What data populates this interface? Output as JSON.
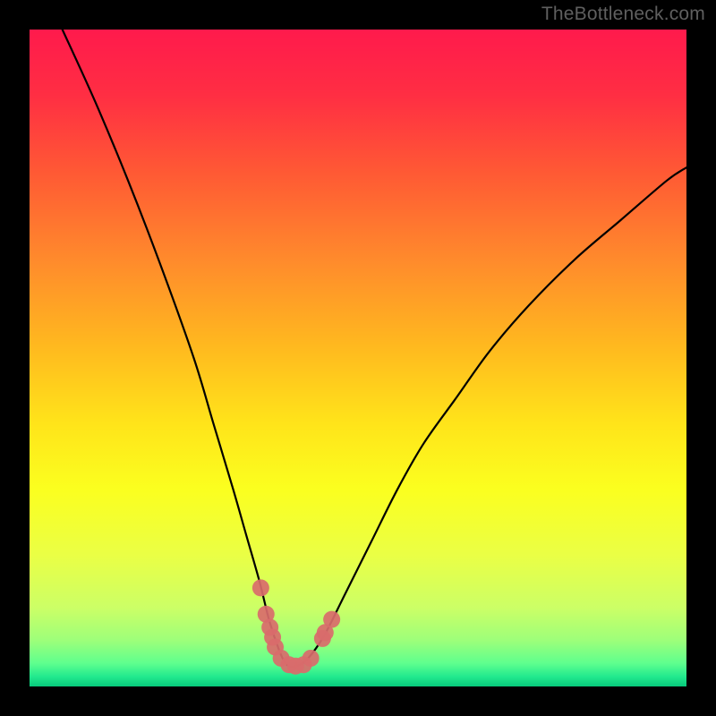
{
  "watermark": "TheBottleneck.com",
  "chart_data": {
    "type": "line",
    "title": "",
    "xlabel": "",
    "ylabel": "",
    "xlim": [
      0,
      100
    ],
    "ylim": [
      0,
      100
    ],
    "series": [
      {
        "name": "bottleneck-curve",
        "x": [
          5,
          10,
          15,
          20,
          25,
          28,
          31,
          33,
          35,
          36.5,
          38,
          39,
          40,
          41.5,
          43,
          45,
          48,
          52,
          56,
          60,
          65,
          70,
          76,
          83,
          90,
          97,
          100
        ],
        "y": [
          100,
          89,
          77,
          64,
          50,
          40,
          30,
          23,
          16,
          10,
          5.5,
          3.5,
          3,
          3.5,
          5,
          8,
          14,
          22,
          30,
          37,
          44,
          51,
          58,
          65,
          71,
          77,
          79
        ]
      }
    ],
    "highlight_band": {
      "y_from": 0,
      "y_to": 3,
      "color_note": "optimal green band"
    },
    "markers": {
      "name": "bottleneck-markers",
      "points": [
        {
          "x": 35.2,
          "y": 15
        },
        {
          "x": 36.0,
          "y": 11
        },
        {
          "x": 36.6,
          "y": 9
        },
        {
          "x": 37.0,
          "y": 7.5
        },
        {
          "x": 37.4,
          "y": 6
        },
        {
          "x": 38.3,
          "y": 4.3
        },
        {
          "x": 39.5,
          "y": 3.3
        },
        {
          "x": 40.5,
          "y": 3.1
        },
        {
          "x": 41.7,
          "y": 3.3
        },
        {
          "x": 42.8,
          "y": 4.3
        },
        {
          "x": 44.6,
          "y": 7.3
        },
        {
          "x": 45.0,
          "y": 8.2
        },
        {
          "x": 46.0,
          "y": 10.2
        }
      ]
    },
    "gradient_stops": [
      {
        "offset": 0.0,
        "color": "#ff1a4c"
      },
      {
        "offset": 0.1,
        "color": "#ff2e43"
      },
      {
        "offset": 0.22,
        "color": "#ff5a34"
      },
      {
        "offset": 0.35,
        "color": "#ff8a2c"
      },
      {
        "offset": 0.48,
        "color": "#ffb81f"
      },
      {
        "offset": 0.6,
        "color": "#ffe41a"
      },
      {
        "offset": 0.7,
        "color": "#fbff1f"
      },
      {
        "offset": 0.8,
        "color": "#eaff45"
      },
      {
        "offset": 0.88,
        "color": "#ccff66"
      },
      {
        "offset": 0.93,
        "color": "#9dff7a"
      },
      {
        "offset": 0.965,
        "color": "#5eff8e"
      },
      {
        "offset": 0.985,
        "color": "#22e98e"
      },
      {
        "offset": 1.0,
        "color": "#07c97b"
      }
    ]
  }
}
